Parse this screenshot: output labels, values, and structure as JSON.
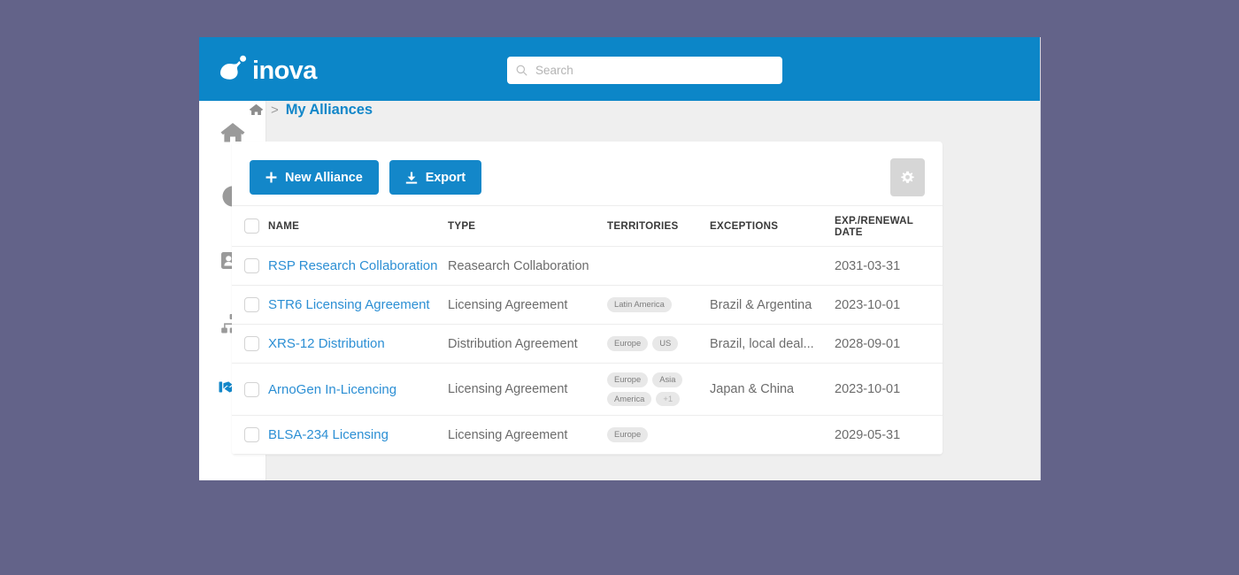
{
  "colors": {
    "page_background": "#636389",
    "brand_blue": "#0c86c8",
    "accent_blue": "#1387c9",
    "link_blue": "#2c8fd4",
    "content_background": "#efefef",
    "card_background": "#ffffff",
    "gear_button": "#d6d6d6",
    "badge_background": "#e8e8e8"
  },
  "header": {
    "logo_text": "inova",
    "logo_icon": "inova-droplet-logo",
    "search": {
      "icon": "search-icon",
      "placeholder": "Search",
      "value": ""
    }
  },
  "sidebar": {
    "items": [
      {
        "icon": "home-icon",
        "name": "home",
        "active": false
      },
      {
        "icon": "pie-chart-icon",
        "name": "reports",
        "active": false
      },
      {
        "icon": "id-card-icon",
        "name": "contacts",
        "active": false
      },
      {
        "icon": "sitemap-icon",
        "name": "organizations",
        "active": false
      },
      {
        "icon": "handshake-icon",
        "name": "alliances",
        "active": true
      }
    ]
  },
  "breadcrumb": {
    "home_icon": "home-icon",
    "separator": ">",
    "current": "My Alliances"
  },
  "toolbar": {
    "new_alliance_label": "New Alliance",
    "new_alliance_icon": "plus-icon",
    "export_label": "Export",
    "export_icon": "download-icon",
    "settings_icon": "gear-icon"
  },
  "table": {
    "columns": [
      {
        "key": "select",
        "label": ""
      },
      {
        "key": "name",
        "label": "NAME"
      },
      {
        "key": "type",
        "label": "TYPE"
      },
      {
        "key": "territories",
        "label": "TERRITORIES"
      },
      {
        "key": "exceptions",
        "label": "EXCEPTIONS"
      },
      {
        "key": "date",
        "label": "EXP./RENEWAL DATE"
      }
    ],
    "rows": [
      {
        "name": "RSP Research Collaboration",
        "type": "Reasearch Collaboration",
        "territories": [],
        "exceptions": "",
        "date": "2031-03-31",
        "selected": false
      },
      {
        "name": "STR6 Licensing Agreement",
        "type": "Licensing Agreement",
        "territories": [
          "Latin America"
        ],
        "exceptions": "Brazil & Argentina",
        "date": "2023-10-01",
        "selected": false
      },
      {
        "name": "XRS-12 Distribution",
        "type": "Distribution Agreement",
        "territories": [
          "Europe",
          "US"
        ],
        "exceptions": "Brazil, local deal...",
        "date": "2028-09-01",
        "selected": false
      },
      {
        "name": "ArnoGen In-Licencing",
        "type": "Licensing Agreement",
        "territories": [
          "Europe",
          "Asia",
          "America",
          "+1"
        ],
        "exceptions": "Japan & China",
        "date": "2023-10-01",
        "selected": false
      },
      {
        "name": "BLSA-234 Licensing",
        "type": "Licensing Agreement",
        "territories": [
          "Europe"
        ],
        "exceptions": "",
        "date": "2029-05-31",
        "selected": false
      }
    ]
  }
}
